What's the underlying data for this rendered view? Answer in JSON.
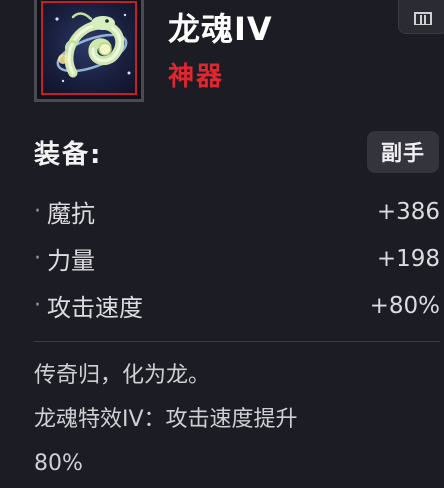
{
  "item": {
    "name": "龙魂IV",
    "rarity": "神器",
    "rarity_color": "#e0262e",
    "icon": "dragon-soul-icon"
  },
  "equip": {
    "label": "装备:",
    "slot_button": "副手"
  },
  "stats": [
    {
      "bullet": "·",
      "name": "魔抗",
      "value": "+386"
    },
    {
      "bullet": "·",
      "name": "力量",
      "value": "+198"
    },
    {
      "bullet": "·",
      "name": "攻击速度",
      "value": "+80%"
    }
  ],
  "description": {
    "line1": "传奇归，化为龙。",
    "line2": "龙魂特效IV：攻击速度提升",
    "line3": "80%"
  },
  "actions": {
    "trash_icon": "trash-icon"
  }
}
